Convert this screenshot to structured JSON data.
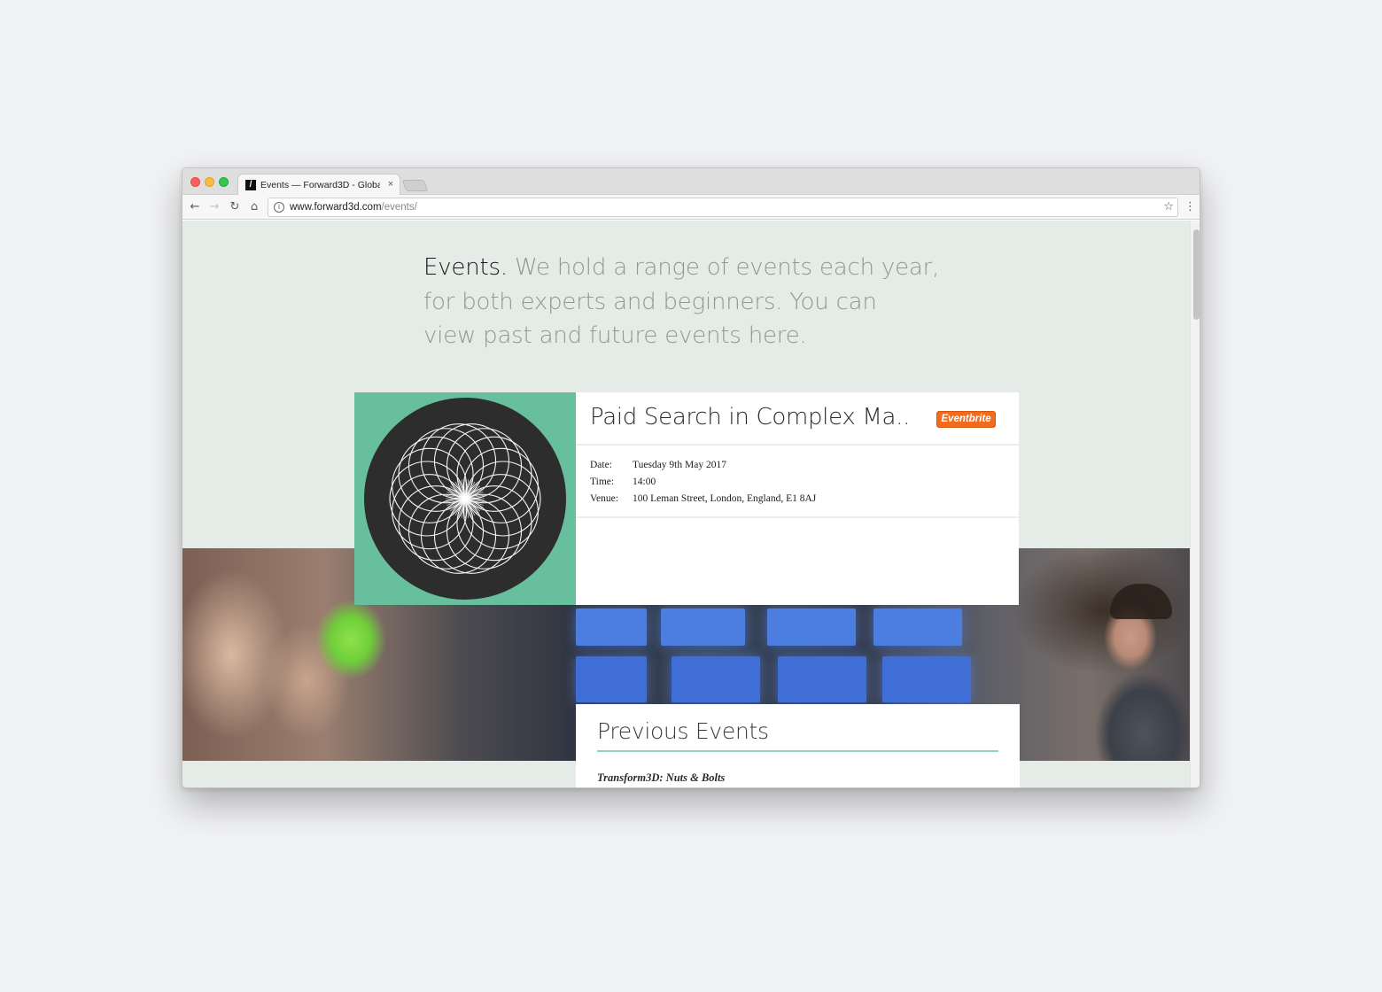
{
  "browser": {
    "tab_title": "Events — Forward3D - Global",
    "tab_close": "×",
    "favicon_glyph": "/",
    "url_host": "www.forward3d.com",
    "url_path": "/events/",
    "info_glyph": "i",
    "icons": {
      "back": "←",
      "forward": "→",
      "reload": "↻",
      "home": "⌂",
      "star": "☆",
      "menu": "⋮"
    }
  },
  "intro": {
    "title": "Events.",
    "line1_rest": " We hold a range of events each year,",
    "line2": "for both experts and beginners.  You can",
    "line3": "view past and future events here."
  },
  "event": {
    "title": "Paid Search in Complex Ma..",
    "badge": "Eventbrite",
    "art_background": "#68bf9d",
    "art_circle": "#2d2d2d",
    "details": [
      {
        "label": "Date:",
        "value": "Tuesday 9th May 2017"
      },
      {
        "label": "Time:",
        "value": "14:00"
      },
      {
        "label": "Venue:",
        "value": "100 Leman Street, London, England, E1 8AJ"
      }
    ]
  },
  "previous": {
    "heading": "Previous Events",
    "items": [
      "Transform3D: Nuts & Bolts"
    ]
  },
  "colors": {
    "accent_green": "#68bf9d",
    "badge_orange": "#f26a1b",
    "page_background": "#e5ebe7"
  }
}
